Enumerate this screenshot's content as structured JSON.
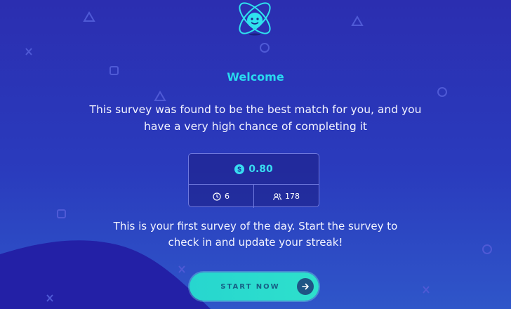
{
  "welcome_title": "Welcome",
  "intro_text": "This survey was found to be the best match for you, and you have a very high chance of completing it",
  "reward": {
    "amount": "0.80",
    "duration": "6",
    "participants": "178",
    "coin_icon": "dollar-coin-icon",
    "duration_icon": "clock-icon",
    "participants_icon": "users-icon"
  },
  "streak_text": "This is your first survey of the day. Start the survey to check in and update your streak!",
  "start_button": {
    "label": "START NOW",
    "icon": "arrow-right-icon"
  },
  "colors": {
    "background_top": "#2b2eb0",
    "background_bottom": "#2f56c9",
    "accent_cyan": "#29d9ef",
    "button_teal": "#2ee0cc",
    "button_text": "#175f86"
  }
}
